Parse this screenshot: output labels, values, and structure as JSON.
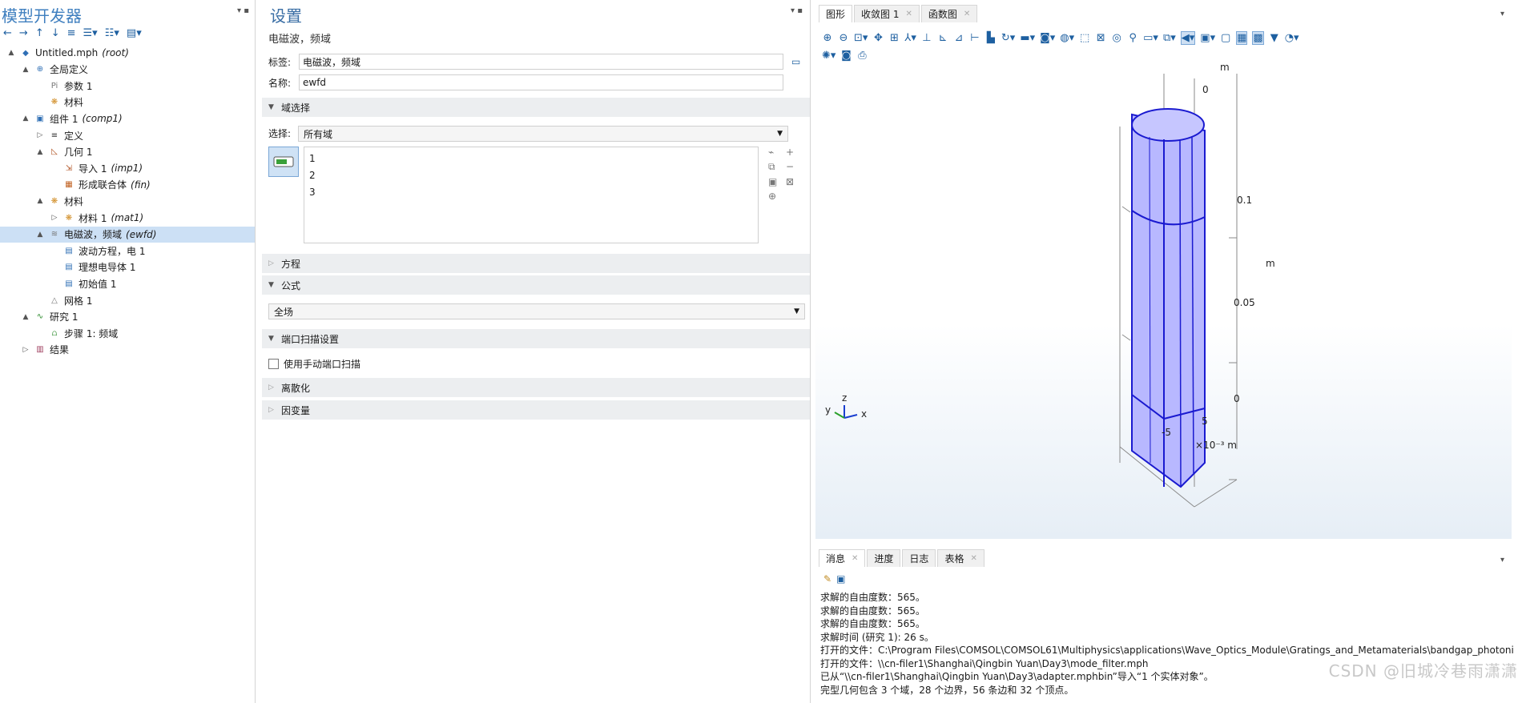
{
  "model_builder": {
    "title": "模型开发器",
    "tree": [
      {
        "label": "Untitled.mph",
        "tag": "(root)",
        "depth": 0,
        "twisty": "▲",
        "icon": "model-icon"
      },
      {
        "label": "全局定义",
        "tag": "",
        "depth": 1,
        "twisty": "▲",
        "icon": "globe-icon"
      },
      {
        "label": "参数 1",
        "tag": "",
        "depth": 2,
        "twisty": "",
        "icon": "parameters-icon"
      },
      {
        "label": "材料",
        "tag": "",
        "depth": 2,
        "twisty": "",
        "icon": "materials-icon"
      },
      {
        "label": "组件 1",
        "tag": "(comp1)",
        "depth": 1,
        "twisty": "▲",
        "icon": "component-icon"
      },
      {
        "label": "定义",
        "tag": "",
        "depth": 2,
        "twisty": "▷",
        "icon": "definitions-icon"
      },
      {
        "label": "几何 1",
        "tag": "",
        "depth": 2,
        "twisty": "▲",
        "icon": "geometry-icon"
      },
      {
        "label": "导入 1",
        "tag": "(imp1)",
        "depth": 3,
        "twisty": "",
        "icon": "import-icon"
      },
      {
        "label": "形成联合体",
        "tag": "(fin)",
        "depth": 3,
        "twisty": "",
        "icon": "form-union-icon"
      },
      {
        "label": "材料",
        "tag": "",
        "depth": 2,
        "twisty": "▲",
        "icon": "materials-icon"
      },
      {
        "label": "材料 1",
        "tag": "(mat1)",
        "depth": 3,
        "twisty": "▷",
        "icon": "material-icon"
      },
      {
        "label": "电磁波，频域",
        "tag": "(ewfd)",
        "depth": 2,
        "twisty": "▲",
        "icon": "physics-icon",
        "selected": true
      },
      {
        "label": "波动方程，电 1",
        "tag": "",
        "depth": 3,
        "twisty": "",
        "icon": "wave-equation-icon"
      },
      {
        "label": "理想电导体 1",
        "tag": "",
        "depth": 3,
        "twisty": "",
        "icon": "pec-icon"
      },
      {
        "label": "初始值 1",
        "tag": "",
        "depth": 3,
        "twisty": "",
        "icon": "initial-values-icon"
      },
      {
        "label": "网格 1",
        "tag": "",
        "depth": 2,
        "twisty": "",
        "icon": "mesh-icon"
      },
      {
        "label": "研究 1",
        "tag": "",
        "depth": 1,
        "twisty": "▲",
        "icon": "study-icon"
      },
      {
        "label": "步骤 1: 频域",
        "tag": "",
        "depth": 2,
        "twisty": "",
        "icon": "step-icon"
      },
      {
        "label": "结果",
        "tag": "",
        "depth": 1,
        "twisty": "▷",
        "icon": "results-icon"
      }
    ]
  },
  "settings": {
    "title": "设置",
    "subtitle": "电磁波，频域",
    "label_field": {
      "label": "标签:",
      "value": "电磁波，频域"
    },
    "name_field": {
      "label": "名称:",
      "value": "ewfd"
    },
    "sections": {
      "domain_selection": "域选择",
      "equation": "方程",
      "formulation": "公式",
      "port_sweep": "端口扫描设置",
      "discretization": "离散化",
      "dependent_variables": "因变量"
    },
    "selection_label": "选择:",
    "selection_value": "所有域",
    "domains": [
      "1",
      "2",
      "3"
    ],
    "formulation_value": "全场",
    "manual_port_sweep": "使用手动端口扫描"
  },
  "graphics": {
    "tabs": [
      {
        "label": "图形",
        "active": true
      },
      {
        "label": "收敛图 1",
        "active": false
      },
      {
        "label": "函数图",
        "active": false
      }
    ],
    "axis_unit": "m",
    "z_ticks": [
      "0",
      "0.05",
      "0.1"
    ],
    "top_tick": "0",
    "x_ticks": [
      "5",
      "-5"
    ],
    "x_scale": "×10⁻³ m",
    "triad": {
      "x": "x",
      "y": "y",
      "z": "z"
    },
    "colors": {
      "geometry_fill": "#b8b8ff",
      "geometry_edge": "#1a1ad0"
    }
  },
  "messages": {
    "tabs": [
      {
        "label": "消息",
        "active": true
      },
      {
        "label": "进度",
        "active": false
      },
      {
        "label": "日志",
        "active": false
      },
      {
        "label": "表格",
        "active": false
      }
    ],
    "lines": [
      "求解的自由度数：565。",
      "求解的自由度数：565。",
      "求解的自由度数：565。",
      "求解时间 (研究 1): 26 s。",
      "打开的文件：C:\\Program Files\\COMSOL\\COMSOL61\\Multiphysics\\applications\\Wave_Optics_Module\\Gratings_and_Metamaterials\\bandgap_photoni",
      "打开的文件：\\\\cn-filer1\\Shanghai\\Qingbin Yuan\\Day3\\mode_filter.mph",
      "已从“\\\\cn-filer1\\Shanghai\\Qingbin Yuan\\Day3\\adapter.mphbin”导入“1 个实体对象”。",
      "完型几何包含 3 个域，28 个边界，56 条边和 32 个顶点。"
    ]
  },
  "watermark": "CSDN @旧城冷巷雨潇潇"
}
